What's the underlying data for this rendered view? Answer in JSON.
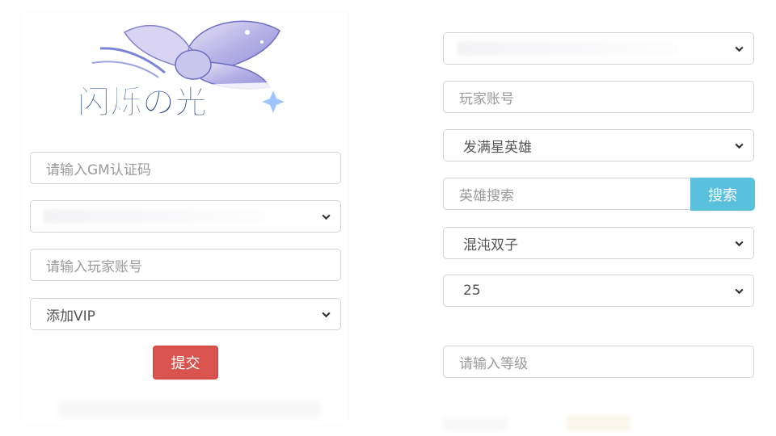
{
  "logo": {
    "text": "闪烁の光"
  },
  "left_form": {
    "gm_code": {
      "placeholder": "请输入GM认证码",
      "value": ""
    },
    "server_select": {
      "selected": ""
    },
    "player_account": {
      "placeholder": "请输入玩家账号",
      "value": ""
    },
    "action_select": {
      "selected": "添加VIP"
    },
    "submit_label": "提交"
  },
  "right_form": {
    "server_select": {
      "selected": ""
    },
    "player_account": {
      "placeholder": "玩家账号",
      "value": ""
    },
    "send_type_select": {
      "selected": "发满星英雄"
    },
    "hero_search": {
      "placeholder": "英雄搜索",
      "value": ""
    },
    "search_label": "搜索",
    "hero_select": {
      "selected": "混沌双子"
    },
    "star_select": {
      "selected": "25"
    },
    "level_input": {
      "placeholder": "请输入等级",
      "value": ""
    }
  },
  "icons": {
    "dropdown": "chevron-down-icon"
  },
  "colors": {
    "submit_button": "#d9534f",
    "search_button": "#5bc0de",
    "border": "#d4d4d4"
  }
}
